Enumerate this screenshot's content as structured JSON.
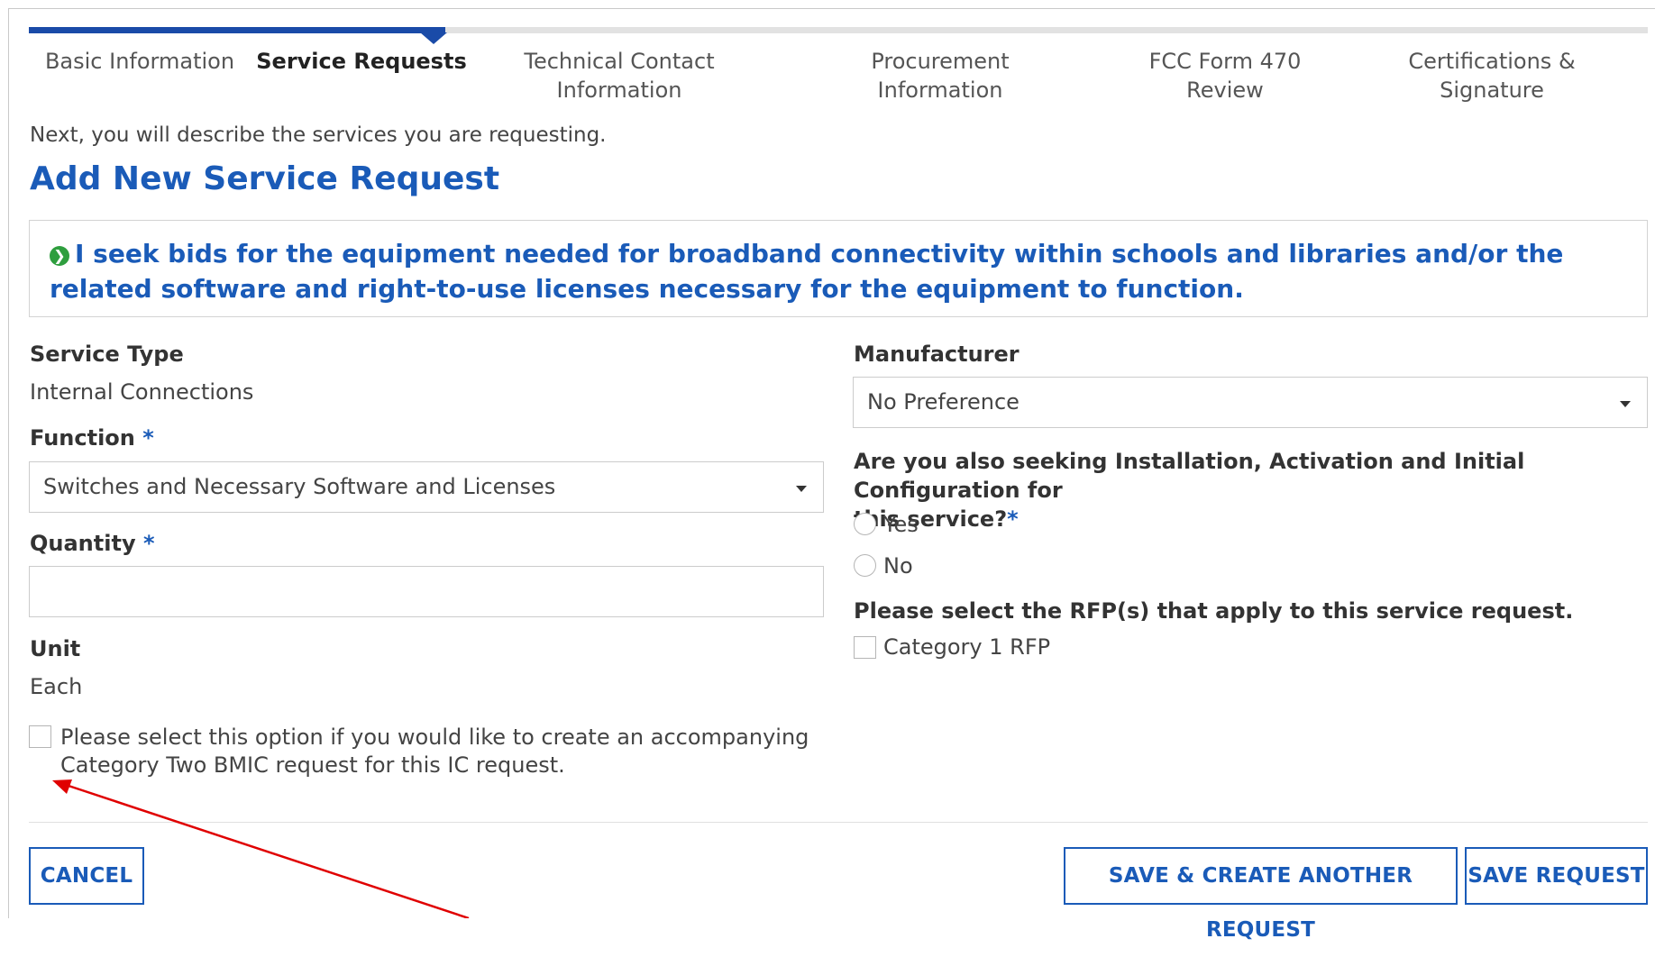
{
  "steps": [
    {
      "label": "Basic Information",
      "active": false
    },
    {
      "label": "Service Requests",
      "active": true
    },
    {
      "label": "Technical Contact Information",
      "active": false
    },
    {
      "label": "Procurement Information",
      "active": false
    },
    {
      "label": "FCC Form 470 Review",
      "active": false
    },
    {
      "label": "Certifications & Signature",
      "active": false
    }
  ],
  "intro_text": "Next, you will describe the services you are requesting.",
  "page_title": "Add New Service Request",
  "description": "I seek bids for the equipment needed for broadband connectivity within schools and libraries and/or the related software and right-to-use licenses necessary for the equipment to function.",
  "left": {
    "service_type_label": "Service Type",
    "service_type_value": "Internal Connections",
    "function_label": "Function",
    "function_value": "Switches and Necessary Software and Licenses",
    "quantity_label": "Quantity",
    "quantity_value": "",
    "unit_label": "Unit",
    "unit_value": "Each",
    "bmic_text_line1": "Please select this option if you would like to create an accompanying",
    "bmic_text_line2": "Category Two BMIC request for this IC request.",
    "bmic_checked": false
  },
  "right": {
    "manufacturer_label": "Manufacturer",
    "manufacturer_value": "No Preference",
    "installation_question_line1": "Are you also seeking Installation, Activation and Initial Configuration for",
    "installation_question_line2": "this service?",
    "radio_yes": "Yes",
    "radio_no": "No",
    "rfp_label": "Please select the RFP(s) that apply to this service request.",
    "rfp_option": "Category 1 RFP"
  },
  "required_marker": "*",
  "buttons": {
    "cancel": "CANCEL",
    "save_and_create": "SAVE & CREATE ANOTHER REQUEST",
    "save": "SAVE REQUEST"
  },
  "colors": {
    "accent": "#1a5bb8",
    "progress": "#1a4ba8",
    "check_icon": "#2e9e3e",
    "annotation_arrow": "#e00000"
  },
  "icons": {
    "description_icon": "check-circle-icon",
    "dropdown_icon": "chevron-down-icon",
    "annotation": "arrow-annotation"
  }
}
